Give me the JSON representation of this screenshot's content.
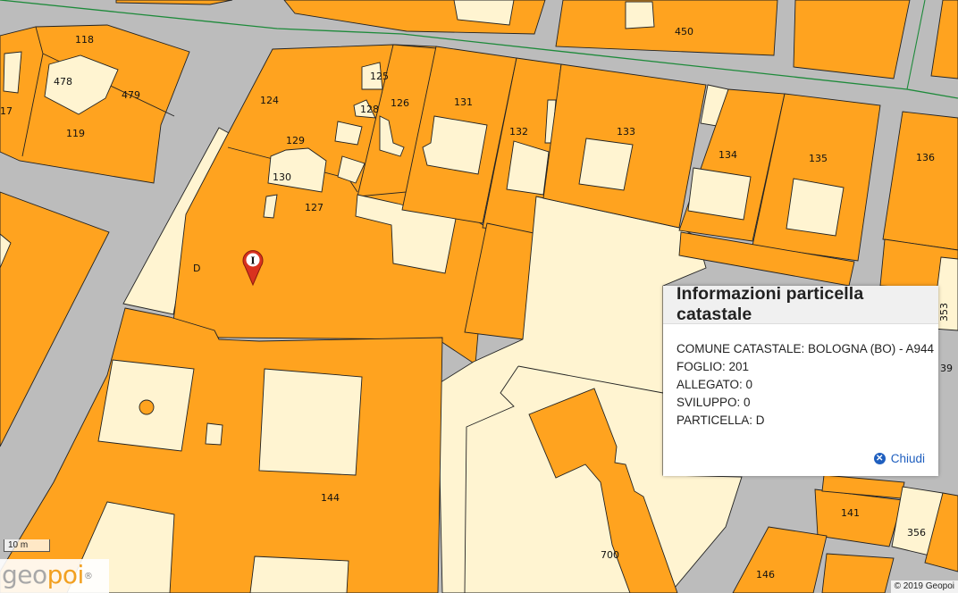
{
  "map": {
    "parcel_labels": [
      "118",
      "478",
      "479",
      "17",
      "119",
      "124",
      "125",
      "128",
      "126",
      "131",
      "129",
      "130",
      "127",
      "132",
      "133",
      "134",
      "135",
      "136",
      "450",
      "D",
      "144",
      "700",
      "141",
      "146",
      "356",
      "353",
      "39"
    ]
  },
  "marker": {
    "glyph": "I",
    "icon": "map-pin-info-icon",
    "color": "#d9321f"
  },
  "panel": {
    "title": "Informazioni particella catastale",
    "rows": [
      "COMUNE CATASTALE: BOLOGNA (BO) - A944",
      "FOGLIO: 201",
      "ALLEGATO: 0",
      "SVILUPPO: 0",
      "PARTICELLA: D"
    ],
    "close_label": "Chiudi",
    "close_icon": "close-circle-icon"
  },
  "scale": {
    "label": "10 m"
  },
  "logo": {
    "part1": "geo",
    "part2": "poi",
    "mark": "®"
  },
  "copyright": "© 2019 Geopoi",
  "colors": {
    "parcel": "#ffa31f",
    "building": "#fff4d1",
    "street": "#bcbcbc",
    "link": "#1f5fbf"
  }
}
